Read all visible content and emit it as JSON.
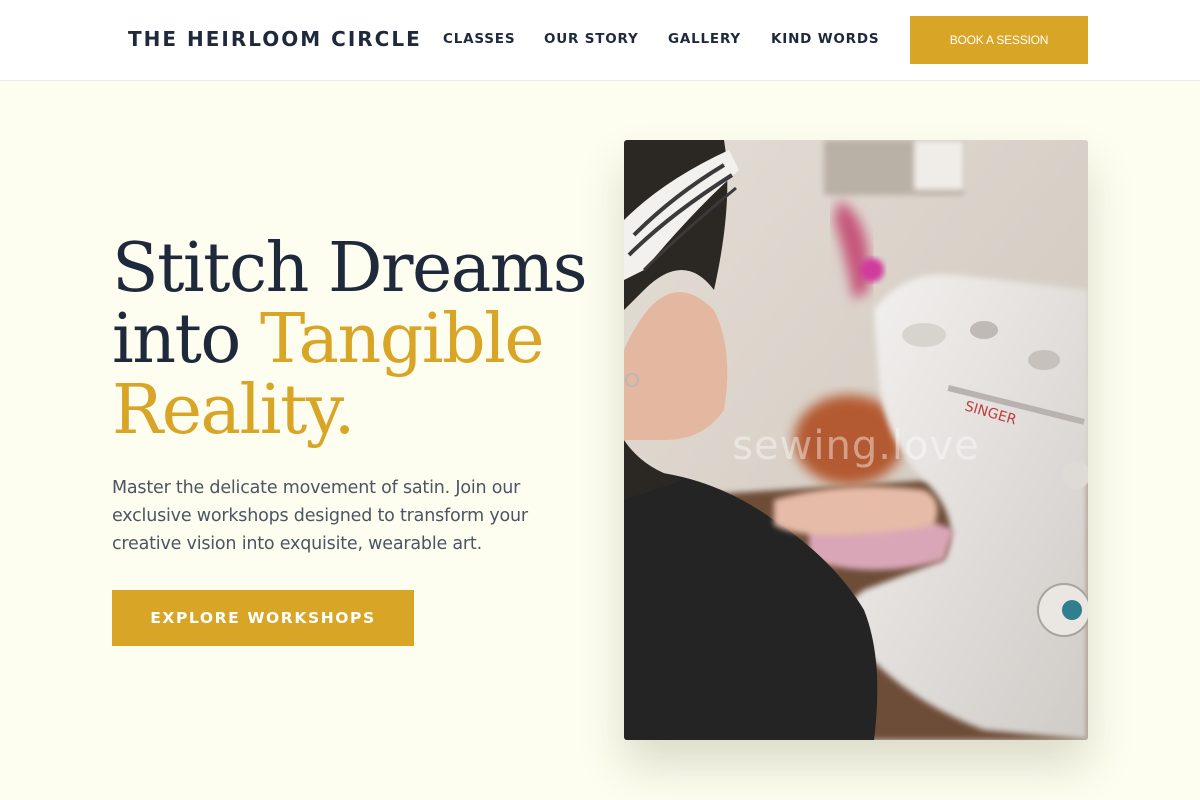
{
  "header": {
    "brand": "THE HEIRLOOM CIRCLE",
    "nav": [
      "CLASSES",
      "OUR STORY",
      "GALLERY",
      "KIND WORDS"
    ],
    "book_button": "BOOK A SESSION"
  },
  "hero": {
    "headline_part1": "Stitch Dreams",
    "headline_part2": "into",
    "headline_accent": "Tangible Reality.",
    "description": "Master the delicate movement of satin. Join our exclusive workshops designed to transform your creative vision into exquisite, wearable art.",
    "cta": "EXPLORE WORKSHOPS",
    "image": {
      "watermark": "sewing.love",
      "machine_brand": "SINGER"
    }
  },
  "colors": {
    "accent": "#d9a526",
    "ink": "#1e293b",
    "body_text": "#4b5563",
    "hero_background": "#fefef0",
    "header_background": "#ffffff"
  },
  "icons": []
}
